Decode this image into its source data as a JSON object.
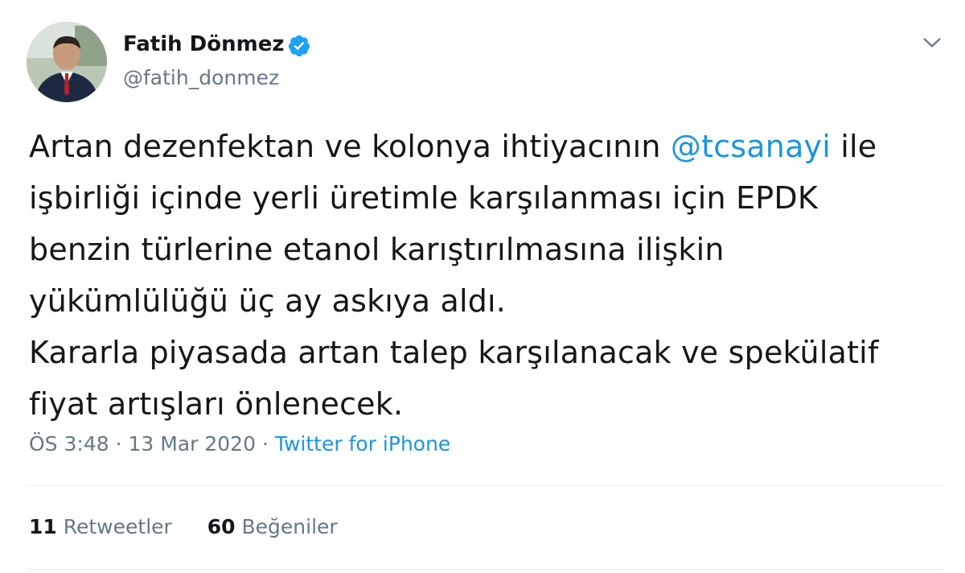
{
  "author": {
    "name": "Fatih Dönmez",
    "handle": "@fatih_donmez",
    "verified": true
  },
  "tweet": {
    "lines": [
      {
        "before": "Artan dezenfektan ve kolonya ihtiyacının ",
        "mention": "@tcsanayi",
        "after": " ile"
      },
      {
        "text": "işbirliği içinde yerli üretimle karşılanması için EPDK"
      },
      {
        "text": "benzin türlerine etanol karıştırılmasına ilişkin"
      },
      {
        "text": "yükümlülüğü üç ay askıya aldı."
      },
      {
        "text": "Kararla piyasada artan talep karşılanacak ve spekülatif"
      },
      {
        "text": "fiyat artışları önlenecek."
      }
    ]
  },
  "meta": {
    "time": "ÖS 3:48",
    "separator": "·",
    "date": "13 Mar 2020",
    "source": "Twitter for iPhone"
  },
  "stats": {
    "retweets_count": "11",
    "retweets_label": "Retweetler",
    "likes_count": "60",
    "likes_label": "Beğeniler"
  },
  "colors": {
    "link": "#1b95e0",
    "secondary": "#657786",
    "primary": "#14171a",
    "divider": "#e6ecf0"
  },
  "icons": {
    "verified": "verified-badge-icon",
    "menu": "chevron-down-icon"
  }
}
